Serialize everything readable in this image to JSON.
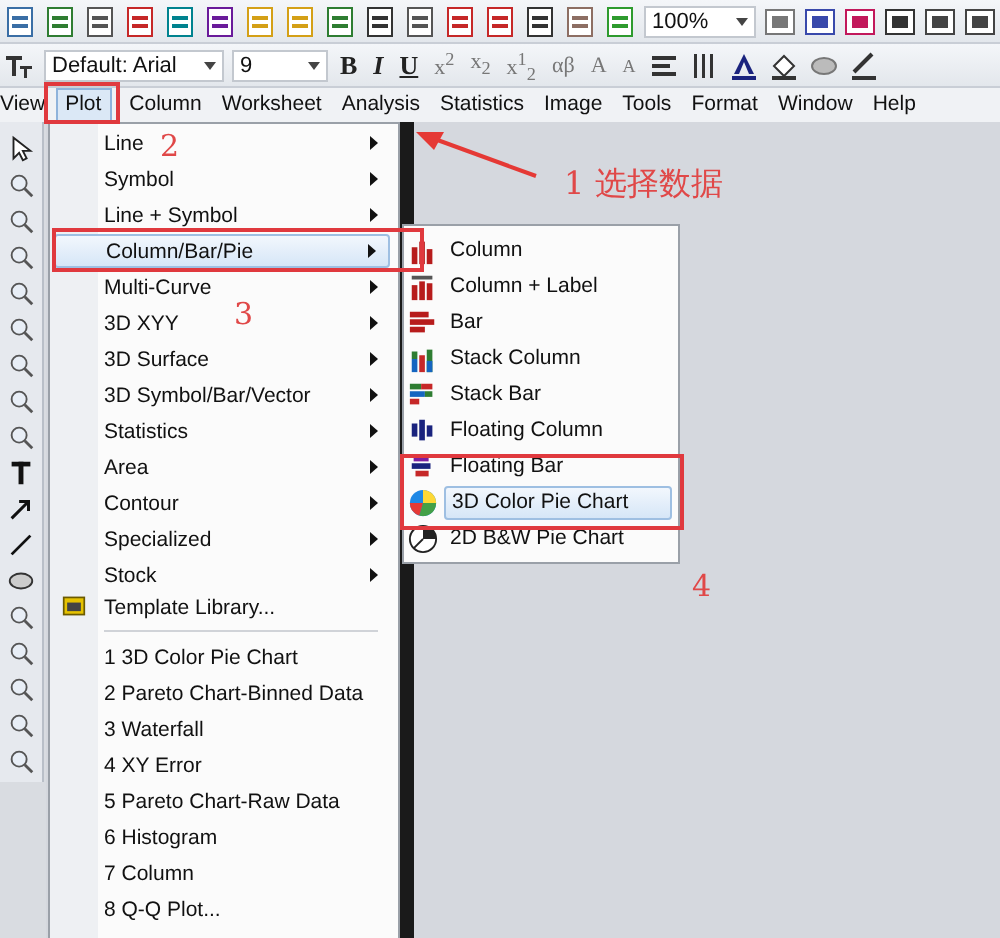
{
  "toolbar_standard": {
    "zoom": "100%"
  },
  "toolbar_format": {
    "font": "Default: Arial",
    "size": "9",
    "buttons": [
      {
        "kind": "bold",
        "text": "B"
      },
      {
        "kind": "italic",
        "text": "I"
      },
      {
        "kind": "underline",
        "text": "U"
      },
      {
        "kind": "plain",
        "text": "x$^{2}$"
      },
      {
        "kind": "plain",
        "text": "x$_{2}$"
      },
      {
        "kind": "plain",
        "text": "x$^{1}$$_{2}$"
      },
      {
        "kind": "plain",
        "text": "αβ"
      },
      {
        "kind": "plain",
        "text": "A"
      },
      {
        "kind": "small",
        "text": "A"
      }
    ]
  },
  "menubar": [
    {
      "label": "View",
      "selected": false
    },
    {
      "label": "Plot",
      "selected": true
    },
    {
      "label": "Column",
      "selected": false
    },
    {
      "label": "Worksheet",
      "selected": false
    },
    {
      "label": "Analysis",
      "selected": false
    },
    {
      "label": "Statistics",
      "selected": false
    },
    {
      "label": "Image",
      "selected": false
    },
    {
      "label": "Tools",
      "selected": false
    },
    {
      "label": "Format",
      "selected": false
    },
    {
      "label": "Window",
      "selected": false
    },
    {
      "label": "Help",
      "selected": false
    }
  ],
  "plot_menu": [
    {
      "label": "Line",
      "kind": "submenu",
      "selected": false
    },
    {
      "label": "Symbol",
      "kind": "submenu",
      "selected": false
    },
    {
      "label": "Line + Symbol",
      "kind": "submenu",
      "selected": false
    },
    {
      "label": "Column/Bar/Pie",
      "kind": "submenu",
      "selected": true
    },
    {
      "label": "Multi-Curve",
      "kind": "submenu",
      "selected": false
    },
    {
      "label": "3D XYY",
      "kind": "submenu",
      "selected": false
    },
    {
      "label": "3D Surface",
      "kind": "submenu",
      "selected": false
    },
    {
      "label": "3D Symbol/Bar/Vector",
      "kind": "submenu",
      "selected": false
    },
    {
      "label": "Statistics",
      "kind": "submenu",
      "selected": false
    },
    {
      "label": "Area",
      "kind": "submenu",
      "selected": false
    },
    {
      "label": "Contour",
      "kind": "submenu",
      "selected": false
    },
    {
      "label": "Specialized",
      "kind": "submenu",
      "selected": false
    },
    {
      "label": "Stock",
      "kind": "submenu",
      "selected": false
    },
    {
      "label": "Template Library...",
      "kind": "command",
      "selected": false
    },
    {
      "label": "1 3D Color Pie Chart",
      "kind": "recent",
      "selected": false
    },
    {
      "label": "2 Pareto Chart-Binned Data",
      "kind": "recent",
      "selected": false
    },
    {
      "label": "3 Waterfall",
      "kind": "recent",
      "selected": false
    },
    {
      "label": "4 XY Error",
      "kind": "recent",
      "selected": false
    },
    {
      "label": "5 Pareto Chart-Raw Data",
      "kind": "recent",
      "selected": false
    },
    {
      "label": "6 Histogram",
      "kind": "recent",
      "selected": false
    },
    {
      "label": "7 Column",
      "kind": "recent",
      "selected": false
    },
    {
      "label": "8 Q-Q Plot...",
      "kind": "recent",
      "selected": false
    }
  ],
  "submenu": [
    {
      "label": "Column",
      "kind": "column",
      "selected": false
    },
    {
      "label": "Column + Label",
      "kind": "column-label",
      "selected": false
    },
    {
      "label": "Bar",
      "kind": "bar",
      "selected": false
    },
    {
      "label": "Stack Column",
      "kind": "stack-column",
      "selected": false
    },
    {
      "label": "Stack Bar",
      "kind": "stack-bar",
      "selected": false
    },
    {
      "label": "Floating Column",
      "kind": "floating-column",
      "selected": false
    },
    {
      "label": "Floating Bar",
      "kind": "floating-bar",
      "selected": false
    },
    {
      "label": "3D Color Pie Chart",
      "kind": "pie-3d",
      "selected": true
    },
    {
      "label": "2D B&W Pie Chart",
      "kind": "pie-2d",
      "selected": false
    }
  ],
  "annotations": [
    "2",
    "3",
    "1 选择数据",
    "4"
  ]
}
